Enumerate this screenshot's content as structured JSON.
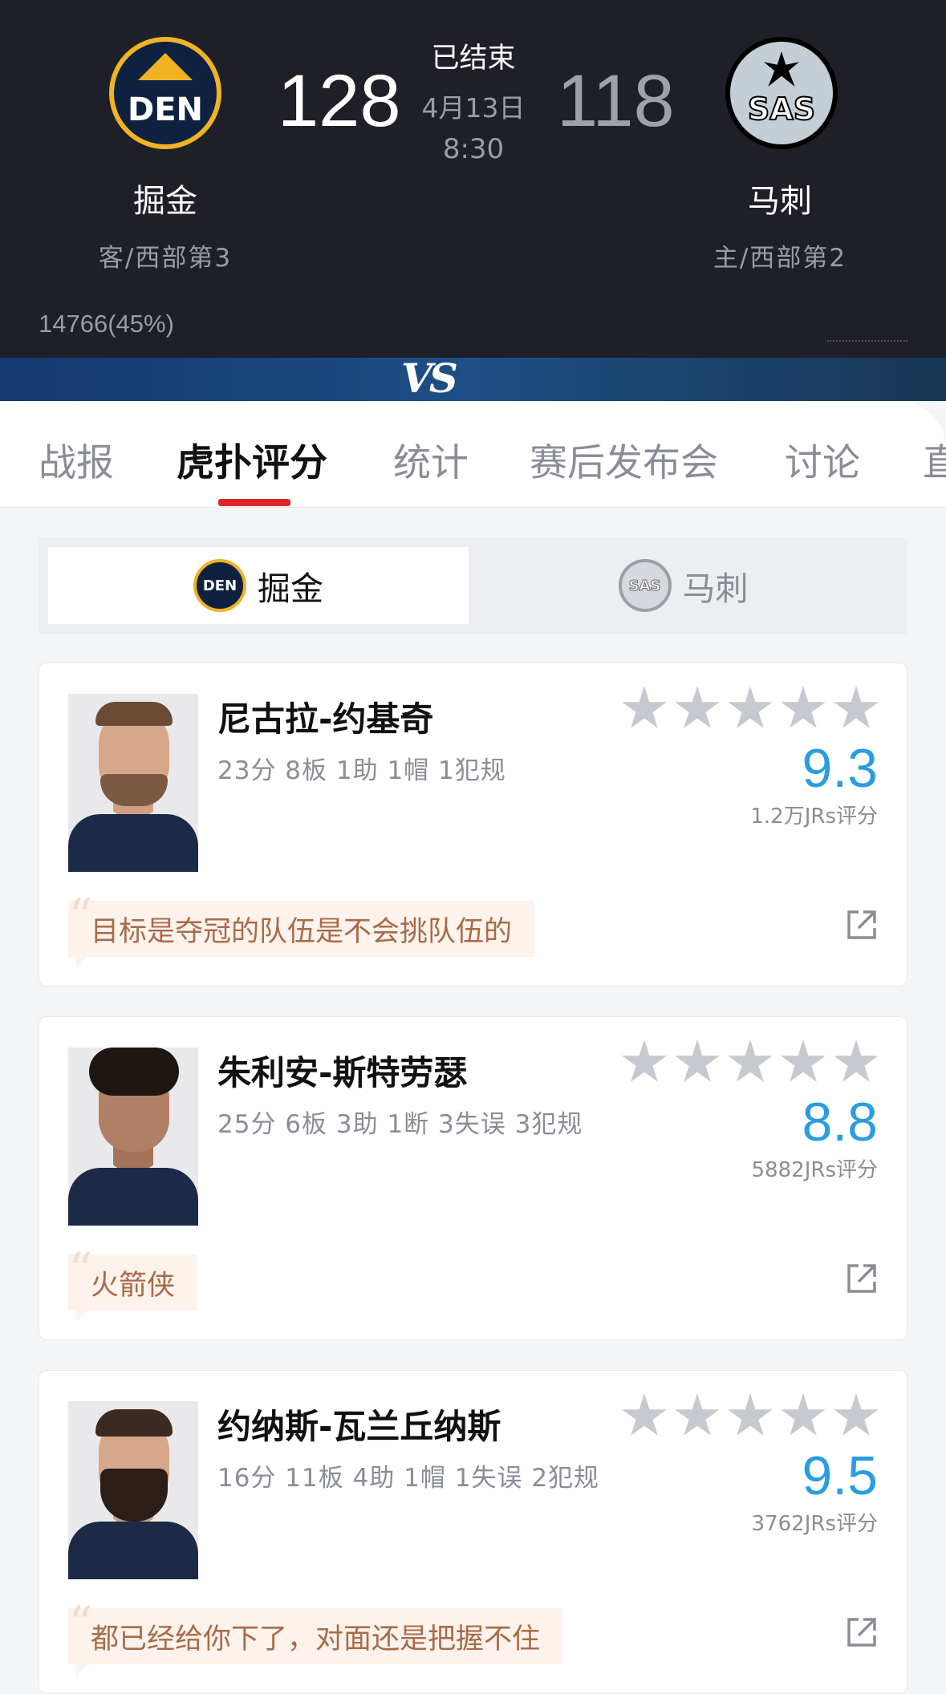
{
  "game": {
    "status": "已结束",
    "date": "4月13日",
    "time": "8:30",
    "home": {
      "name": "掘金",
      "abbr": "DEN",
      "sub": "客/西部第3",
      "score": "128"
    },
    "away": {
      "name": "马刺",
      "abbr": "SAS",
      "sub": "主/西部第2",
      "score": "118"
    },
    "support_left": "14766(45%)",
    "vs": "VS"
  },
  "tabs": [
    {
      "label": "战报"
    },
    {
      "label": "虎扑评分",
      "active": true
    },
    {
      "label": "统计"
    },
    {
      "label": "赛后发布会"
    },
    {
      "label": "讨论"
    },
    {
      "label": "直"
    }
  ],
  "team_switch": {
    "home": {
      "name": "掘金",
      "abbr": "DEN"
    },
    "away": {
      "name": "马刺",
      "abbr": "SAS"
    }
  },
  "players": [
    {
      "name": "尼古拉-约基奇",
      "stats": "23分 8板 1助 1帽 1犯规",
      "rating": "9.3",
      "rating_count": "1.2万JRs评分",
      "quote": "目标是夺冠的队伍是不会挑队伍的",
      "stars": 5
    },
    {
      "name": "朱利安-斯特劳瑟",
      "stats": "25分 6板 3助 1断 3失误 3犯规",
      "rating": "8.8",
      "rating_count": "5882JRs评分",
      "quote": "火箭侠",
      "stars": 5
    },
    {
      "name": "约纳斯-瓦兰丘纳斯",
      "stats": "16分 11板 4助 1帽 1失误 2犯规",
      "rating": "9.5",
      "rating_count": "3762JRs评分",
      "quote": "都已经给你下了，对面还是把握不住",
      "stars": 5
    }
  ],
  "colors": {
    "header_bg": "#1f2027",
    "accent_blue": "#2a9de0",
    "tab_indicator": "#e0262a",
    "quote_text": "#a86b48"
  }
}
